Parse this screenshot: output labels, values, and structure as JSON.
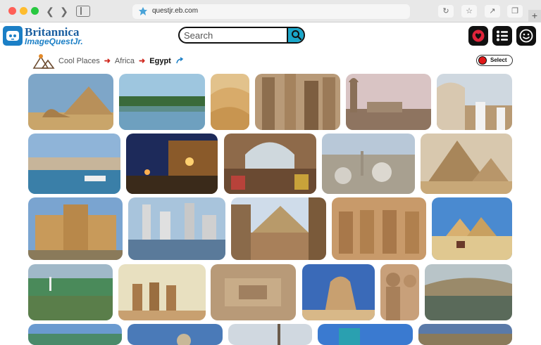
{
  "browser": {
    "url": "questjr.eb.com",
    "back_icon": "chevron-left-icon",
    "forward_icon": "chevron-right-icon"
  },
  "brand": {
    "name": "Britannica",
    "product": "ImageQuestJr."
  },
  "search": {
    "placeholder": "Search"
  },
  "breadcrumb": {
    "items": [
      "Cool Places",
      "Africa",
      "Egypt"
    ]
  },
  "select": {
    "label": "Select"
  },
  "colors": {
    "brand_blue": "#1b7fc6",
    "search_button": "#1aa6c9",
    "accent_red": "#d02a20",
    "icon_bg": "#111111"
  },
  "header_icons": [
    "favorites-icon",
    "list-icon",
    "profile-face-icon"
  ],
  "images": [
    "pyramids-and-sphinx",
    "river-with-palms",
    "sand-dunes",
    "temple-columns-statues",
    "mosque-and-city",
    "camel-and-boys",
    "harbor-with-boats",
    "street-at-night",
    "market-bazaar",
    "cairo-skyline-mosques",
    "giza-pyramids",
    "citadel-fortress",
    "city-waterfront",
    "pyramid-behind-buildings",
    "abu-simbel-temple",
    "camel-rider-pyramids",
    "nile-with-sailboats",
    "temple-ruins",
    "temple-complex-aerial",
    "sphinx-closeup",
    "colossal-statues",
    "nile-boat-cliffs",
    "row5-a",
    "row5-b",
    "row5-c",
    "row5-d",
    "row5-e"
  ]
}
